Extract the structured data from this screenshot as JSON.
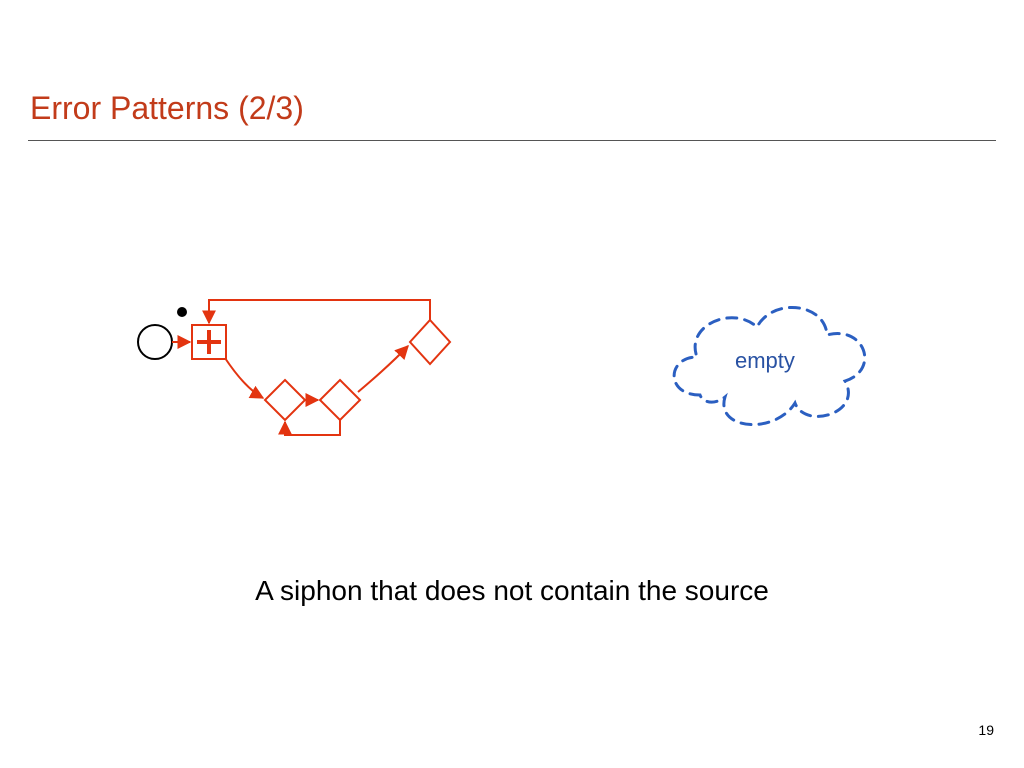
{
  "slide": {
    "title": "Error Patterns (2/3)",
    "caption": "A siphon that does not contain the source",
    "page_number": "19",
    "cloud_label": "empty"
  },
  "colors": {
    "title": "#c23b1a",
    "diagram_stroke": "#e33410",
    "cloud_stroke": "#2b5fc1",
    "cloud_text": "#2952a3"
  }
}
